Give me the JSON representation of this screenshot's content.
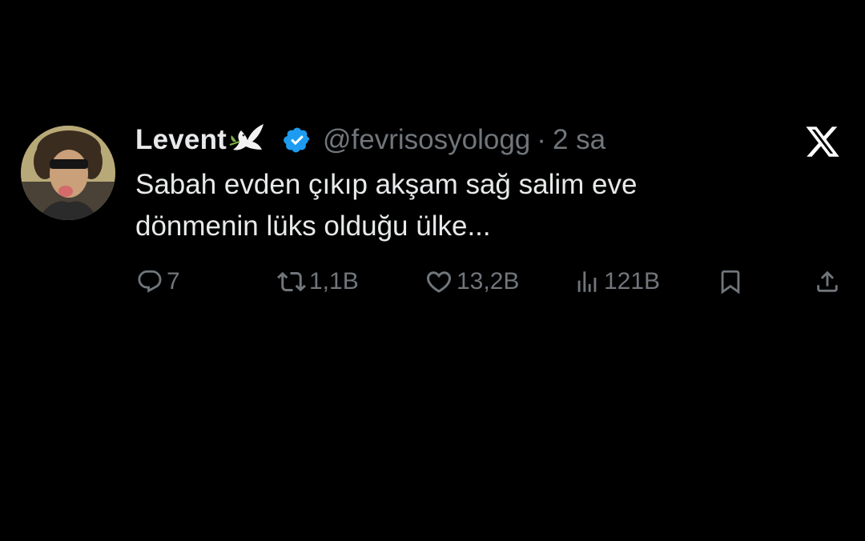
{
  "tweet": {
    "author": {
      "display_name": "Levent",
      "handle": "@fevrisosyologg",
      "verified": true,
      "name_emoji": "dove-icon"
    },
    "separator": "·",
    "time": "2 sa",
    "text_lines": [
      "Sabah evden çıkıp akşam sağ salim eve",
      "dönmenin lüks olduğu ülke..."
    ],
    "actions": {
      "replies": "7",
      "retweets": "1,1B",
      "likes": "13,2B",
      "views": "121B"
    },
    "brand": "x-logo"
  },
  "colors": {
    "background": "#000000",
    "primary_text": "#e7e9ea",
    "secondary_text": "#71767b",
    "verified_blue": "#1d9bf0"
  }
}
